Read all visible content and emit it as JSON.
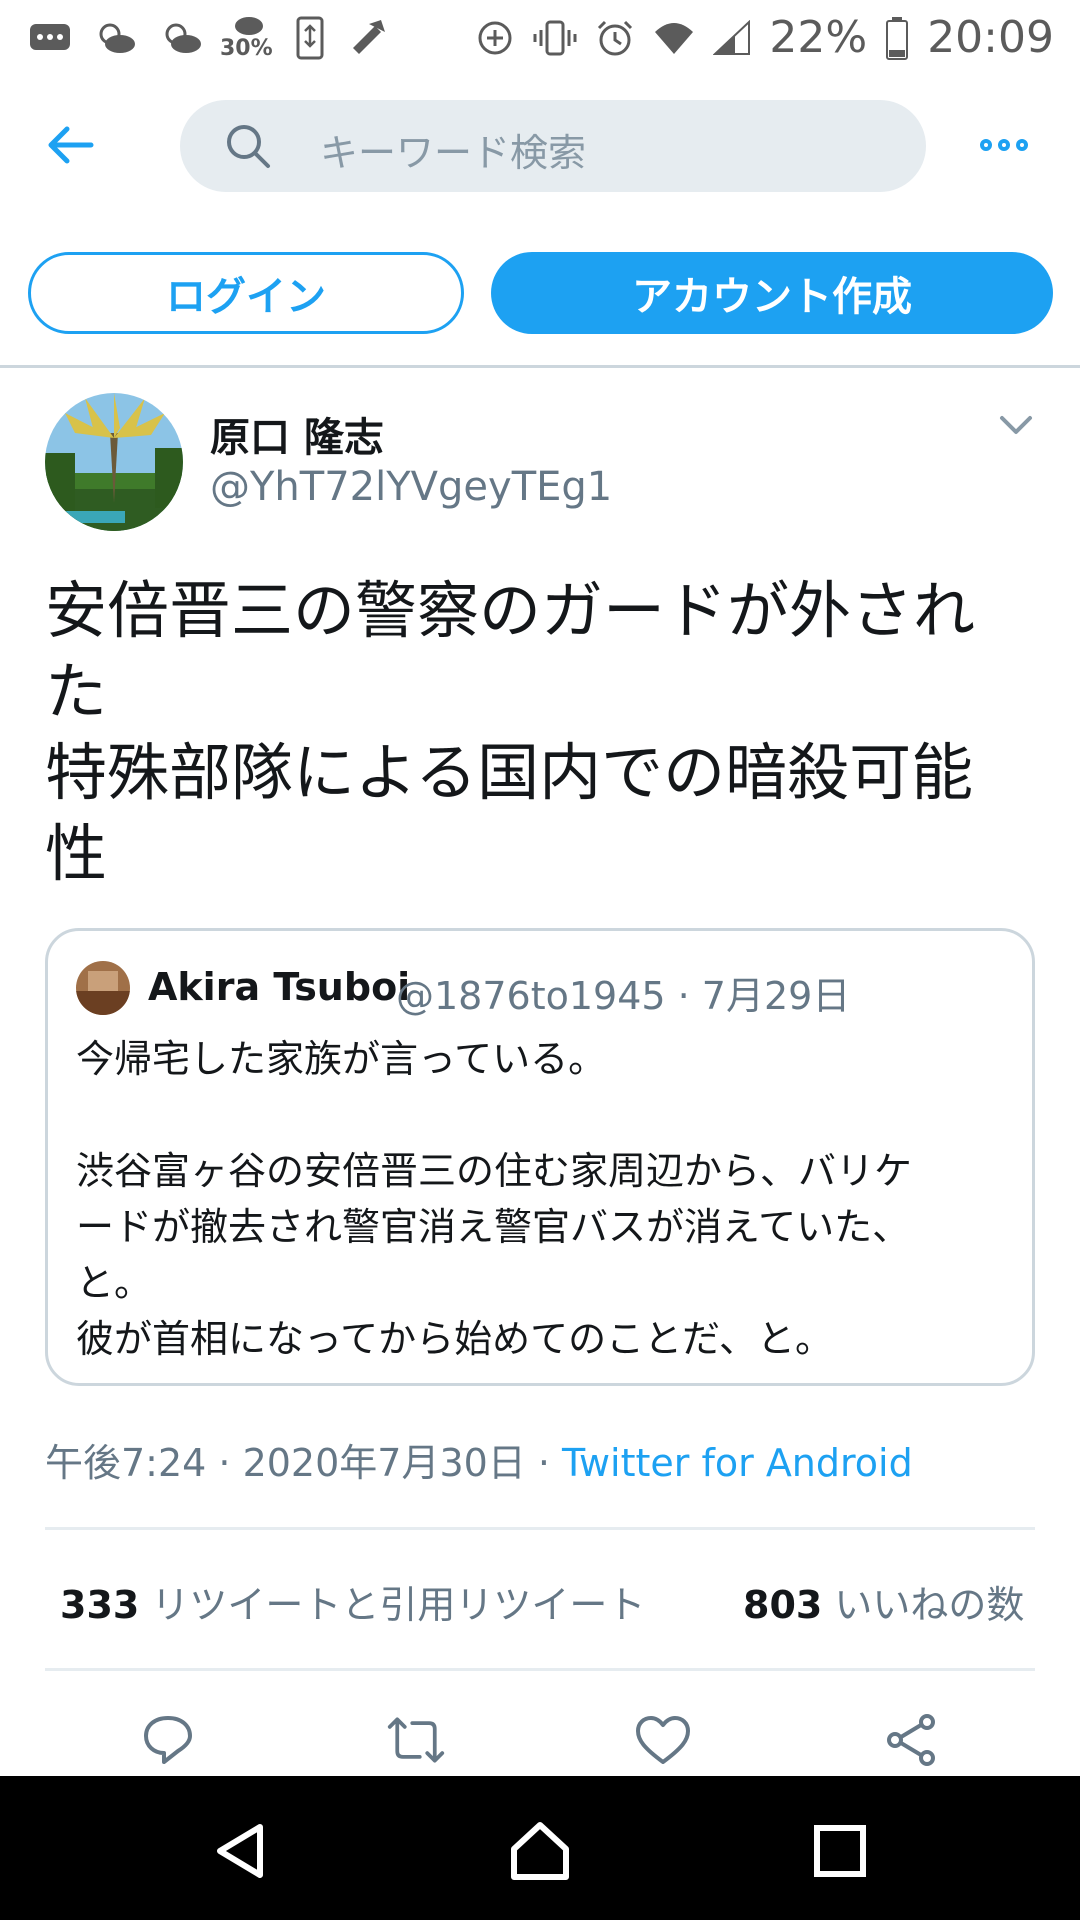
{
  "status_bar": {
    "weather_percent": "30%",
    "battery": "22%",
    "time": "20:09"
  },
  "header": {
    "search_placeholder": "キーワード検索"
  },
  "auth": {
    "login_label": "ログイン",
    "signup_label": "アカウント作成"
  },
  "tweet": {
    "author_name": "原口 隆志",
    "author_handle": "@YhT72lYVgeyTEg1",
    "text": "安倍晋三の警察のガードが外され\nた\n特殊部隊による国内での暗殺可能\n性",
    "quoted": {
      "name": "Akira Tsuboi",
      "meta": "@1876to1945 · 7月29日",
      "text": "今帰宅した家族が言っている。\n\n渋谷富ヶ谷の安倍晋三の住む家周辺から、バリケ\nードが撤去され警官消え警官バスが消えていた、\nと。\n彼が首相になってから始めてのことだ、と。"
    },
    "timestamp": "午後7:24 · 2020年7月30日 · ",
    "source": "Twitter for Android",
    "retweet_count": "333",
    "retweet_label": " リツイートと引用リツイート",
    "like_count": "803",
    "like_label": " いいねの数"
  },
  "colors": {
    "accent": "#1da1f2",
    "secondary_text": "#657786",
    "divider": "#e6ecf0"
  },
  "icons": [
    "back-arrow-icon",
    "search-icon",
    "more-icon",
    "chevron-down-icon",
    "reply-icon",
    "retweet-icon",
    "like-icon",
    "share-icon",
    "nav-back-icon",
    "nav-home-icon",
    "nav-recents-icon"
  ]
}
